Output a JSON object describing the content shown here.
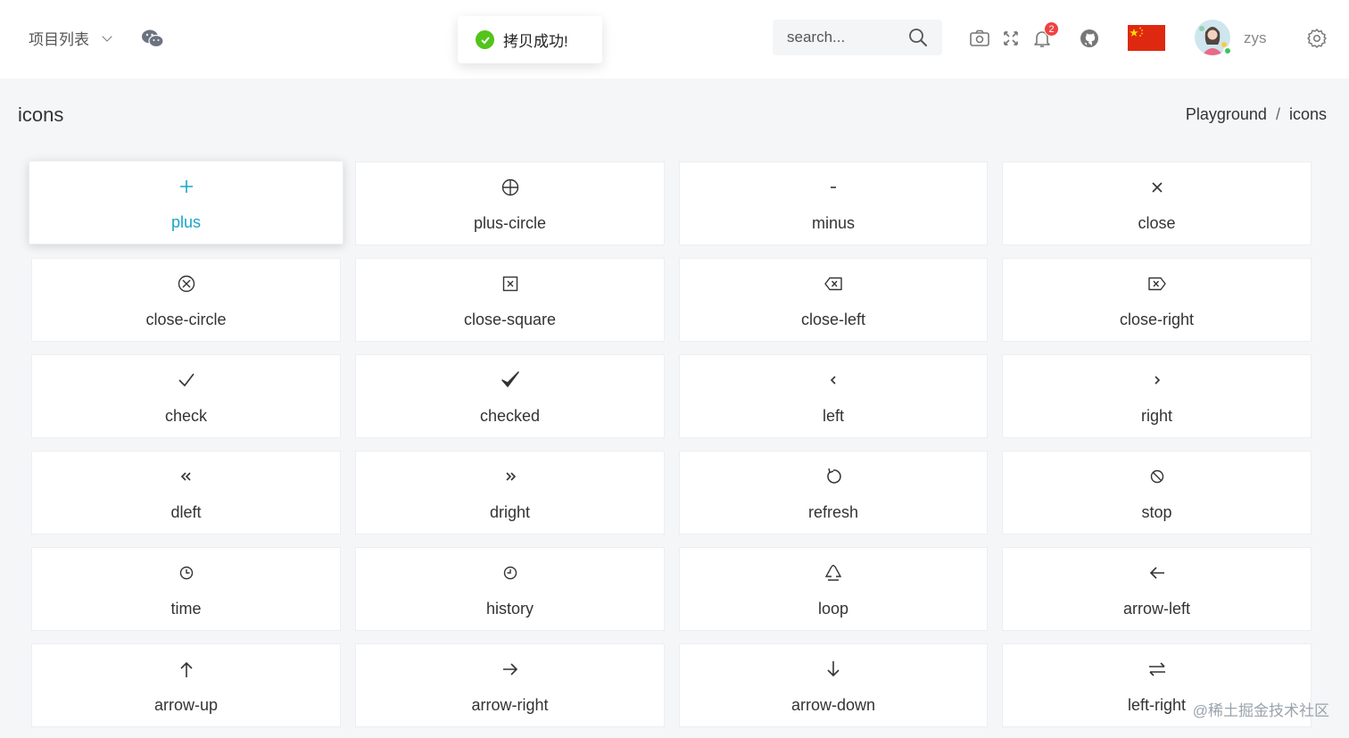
{
  "header": {
    "project_label": "项目列表",
    "search_placeholder": "search...",
    "notification_count": "2",
    "username": "zys"
  },
  "toast": {
    "message": "拷贝成功!"
  },
  "page": {
    "title": "icons",
    "breadcrumb": [
      "Playground",
      "/",
      "icons"
    ]
  },
  "icons": [
    {
      "name": "plus"
    },
    {
      "name": "plus-circle"
    },
    {
      "name": "minus"
    },
    {
      "name": "close"
    },
    {
      "name": "close-circle"
    },
    {
      "name": "close-square"
    },
    {
      "name": "close-left"
    },
    {
      "name": "close-right"
    },
    {
      "name": "check"
    },
    {
      "name": "checked"
    },
    {
      "name": "left"
    },
    {
      "name": "right"
    },
    {
      "name": "dleft"
    },
    {
      "name": "dright"
    },
    {
      "name": "refresh"
    },
    {
      "name": "stop"
    },
    {
      "name": "time"
    },
    {
      "name": "history"
    },
    {
      "name": "loop"
    },
    {
      "name": "arrow-left"
    },
    {
      "name": "arrow-up"
    },
    {
      "name": "arrow-right"
    },
    {
      "name": "arrow-down"
    },
    {
      "name": "left-right"
    }
  ],
  "colors": {
    "accent": "#19a5c6",
    "success": "#52c41a",
    "badge": "#f04141"
  },
  "watermark": "@稀土掘金技术社区"
}
